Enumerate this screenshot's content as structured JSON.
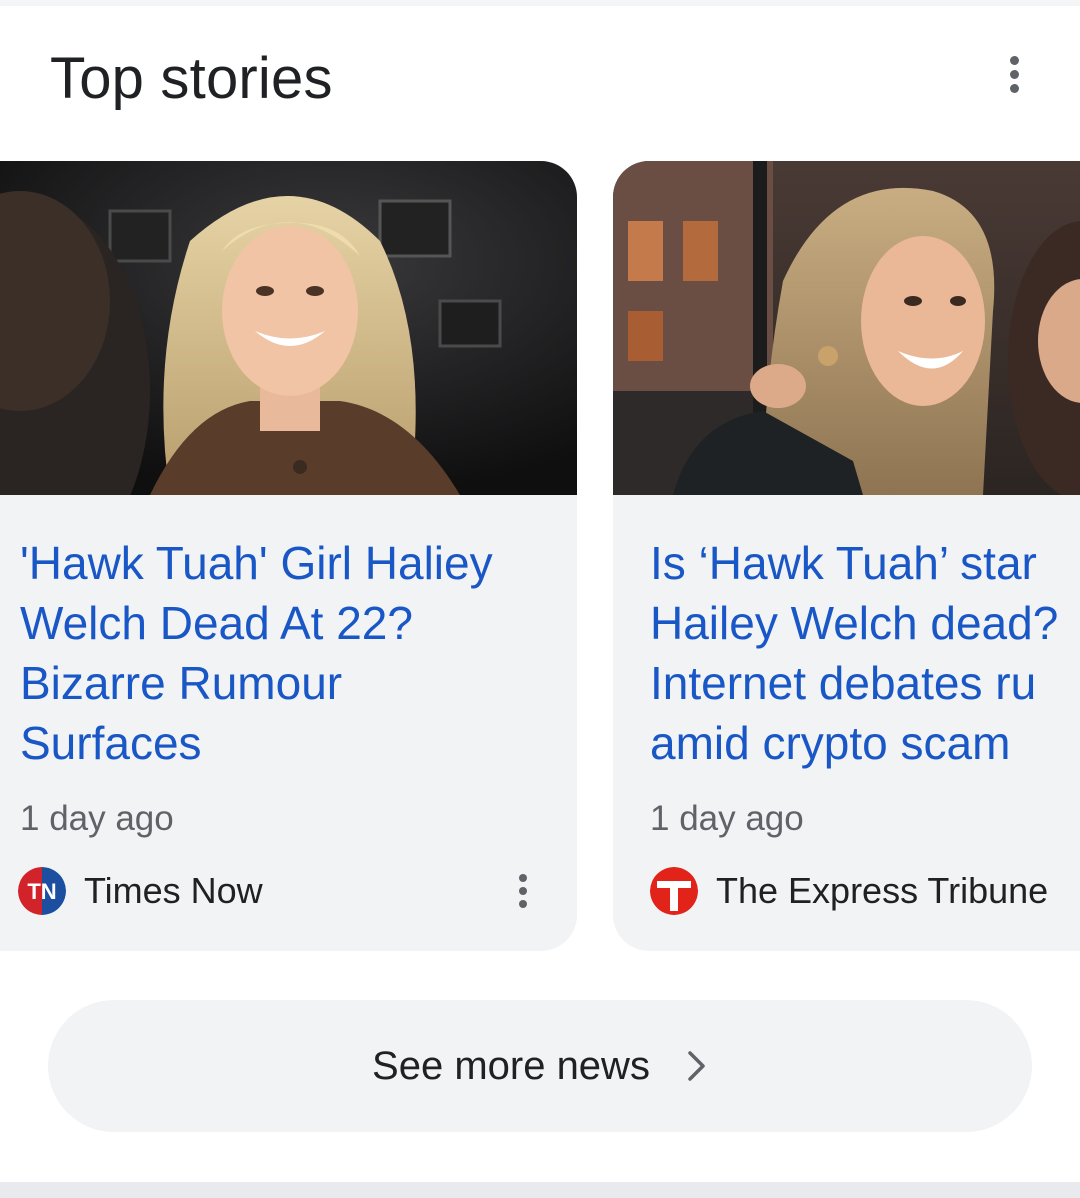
{
  "section": {
    "title": "Top stories"
  },
  "stories": [
    {
      "headline": "'Hawk Tuah' Girl Haliey\nWelch Dead At 22?\nBizarre Rumour\nSurfaces",
      "time": "1 day ago",
      "source": "Times Now",
      "source_logo_text": "TN"
    },
    {
      "headline": "Is ‘Hawk Tuah’ star\nHailey Welch dead?\nInternet debates ru\namid crypto scam",
      "time": "1 day ago",
      "source": "The Express Tribune",
      "source_logo_text": "T"
    }
  ],
  "see_more": {
    "label": "See more news"
  },
  "colors": {
    "headline": "#1a57c6",
    "card_bg": "#f1f3f4",
    "times_now_red": "#d3232a",
    "times_now_blue": "#1c4fa0",
    "express_tribune_red": "#e2231a"
  },
  "icons": {
    "section_menu": "more-vert-icon",
    "card_menu": "more-vert-icon",
    "see_more": "chevron-right-icon"
  }
}
